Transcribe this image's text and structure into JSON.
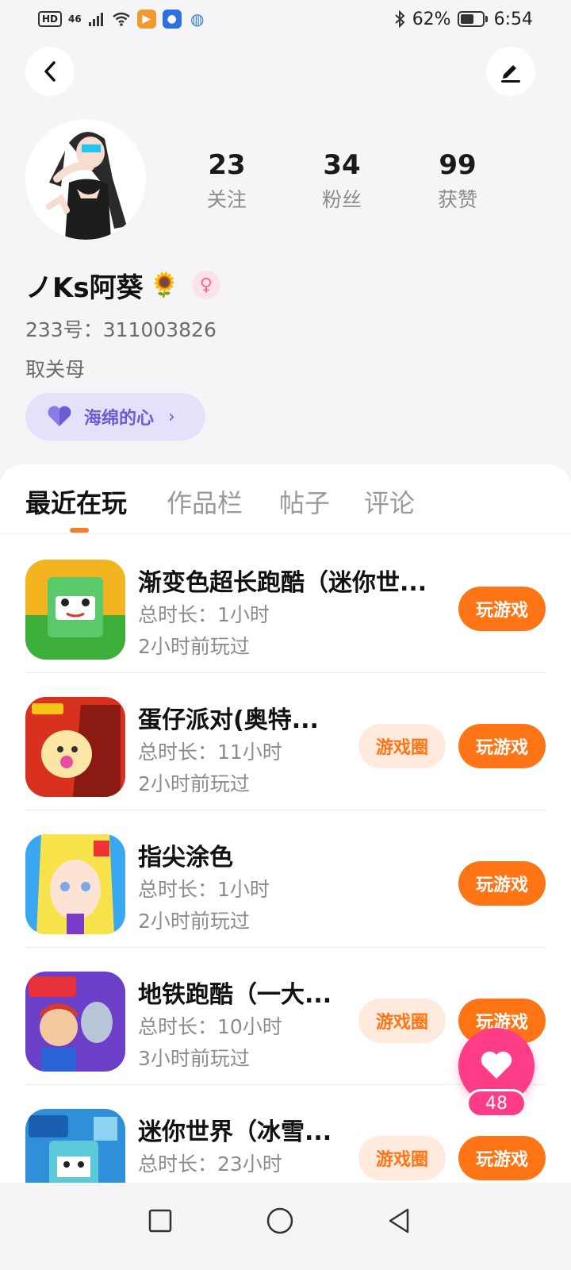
{
  "status_bar": {
    "hd": "HD",
    "network": "46",
    "battery": "62%",
    "time": "6:54",
    "battery_level": 0.62
  },
  "profile": {
    "stats": [
      {
        "value": "23",
        "label": "关注"
      },
      {
        "value": "34",
        "label": "粉丝"
      },
      {
        "value": "99",
        "label": "获赞"
      }
    ],
    "username": "ノKs阿葵",
    "sunflower": "🌻",
    "gender_symbol": "♀",
    "user_id": "233号：311003826",
    "bio": "取关母",
    "badge_label": "海绵的心",
    "badge_chevron": "›"
  },
  "tabs": [
    {
      "label": "最近在玩"
    },
    {
      "label": "作品栏"
    },
    {
      "label": "帖子"
    },
    {
      "label": "评论"
    }
  ],
  "games": [
    {
      "title": "渐变色超长跑酷（迷你世...",
      "duration": "总时长：1小时",
      "last_played": "2小时前玩过",
      "play_label": "玩游戏"
    },
    {
      "title": "蛋仔派对(奥特...",
      "duration": "总时长：11小时",
      "last_played": "2小时前玩过",
      "circle_label": "游戏圈",
      "play_label": "玩游戏"
    },
    {
      "title": "指尖涂色",
      "duration": "总时长：1小时",
      "last_played": "2小时前玩过",
      "play_label": "玩游戏"
    },
    {
      "title": "地铁跑酷（一大...",
      "duration": "总时长：10小时",
      "last_played": "3小时前玩过",
      "circle_label": "游戏圈",
      "play_label": "玩游戏"
    },
    {
      "title": "迷你世界（冰雪...",
      "duration": "总时长：23小时",
      "last_played": "",
      "circle_label": "游戏圈",
      "play_label": "玩游戏"
    }
  ],
  "fab": {
    "count": "48"
  },
  "colors": {
    "accent": "#ff7414",
    "like": "#ff3d86",
    "badge": "#6b5bd6"
  }
}
